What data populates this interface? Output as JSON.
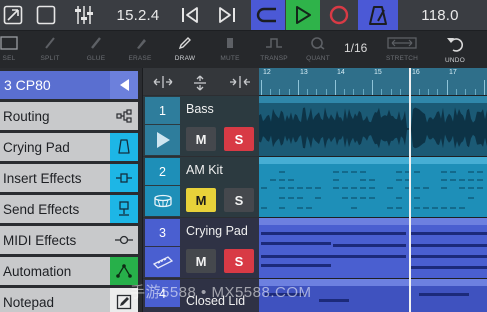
{
  "transport": {
    "position": "15.2.4",
    "tempo": "118.0"
  },
  "tools": {
    "items": [
      {
        "label": "SEL",
        "icon": "select-rect-icon"
      },
      {
        "label": "SPLIT",
        "icon": "split-icon"
      },
      {
        "label": "GLUE",
        "icon": "glue-icon"
      },
      {
        "label": "ERASE",
        "icon": "eraser-icon"
      },
      {
        "label": "DRAW",
        "icon": "pencil-icon"
      },
      {
        "label": "MUTE",
        "icon": "mute-icon"
      },
      {
        "label": "TRANSP",
        "icon": "transpose-icon"
      },
      {
        "label": "QUANT",
        "icon": "quantize-icon"
      },
      {
        "label": "STRETCH",
        "icon": "stretch-icon"
      },
      {
        "label": "UNDO",
        "icon": "undo-icon"
      }
    ],
    "quantize_value": "1/16"
  },
  "inspector": {
    "track_title": "3  CP80",
    "rows": [
      {
        "label": "Routing",
        "icon": "routing-icon"
      },
      {
        "label": "Crying Pad",
        "icon": "instrument-bell-icon"
      },
      {
        "label": "Insert Effects",
        "icon": "insert-effects-icon"
      },
      {
        "label": "Send Effects",
        "icon": "send-effects-icon"
      },
      {
        "label": "MIDI Effects",
        "icon": "midi-effects-icon"
      },
      {
        "label": "Automation",
        "icon": "automation-icon"
      },
      {
        "label": "Notepad",
        "icon": "notepad-icon"
      }
    ]
  },
  "tracks": [
    {
      "number": "1",
      "name": "Bass",
      "type": "audio",
      "mute": "M",
      "solo": "S"
    },
    {
      "number": "2",
      "name": "AM Kit",
      "type": "drum",
      "mute": "M",
      "solo": "S"
    },
    {
      "number": "3",
      "name": "Crying Pad",
      "type": "instrument",
      "mute": "M",
      "solo": "S"
    },
    {
      "number": "4",
      "name": "Closed Lid",
      "type": "instrument"
    }
  ],
  "ruler": {
    "bars": [
      "12",
      "13",
      "14",
      "15",
      "16",
      "17"
    ]
  },
  "watermark": "手游5588 • MX5588.COM",
  "colors": {
    "loop": "#4b59d6",
    "play": "#2fb34a",
    "record": "#d83a45",
    "track_audio": "#2e7d9c",
    "track_drum": "#1e8fb8",
    "track_instr": "#4a5fd0",
    "solo_on": "#d83a45",
    "mute_on": "#e8d23a"
  }
}
